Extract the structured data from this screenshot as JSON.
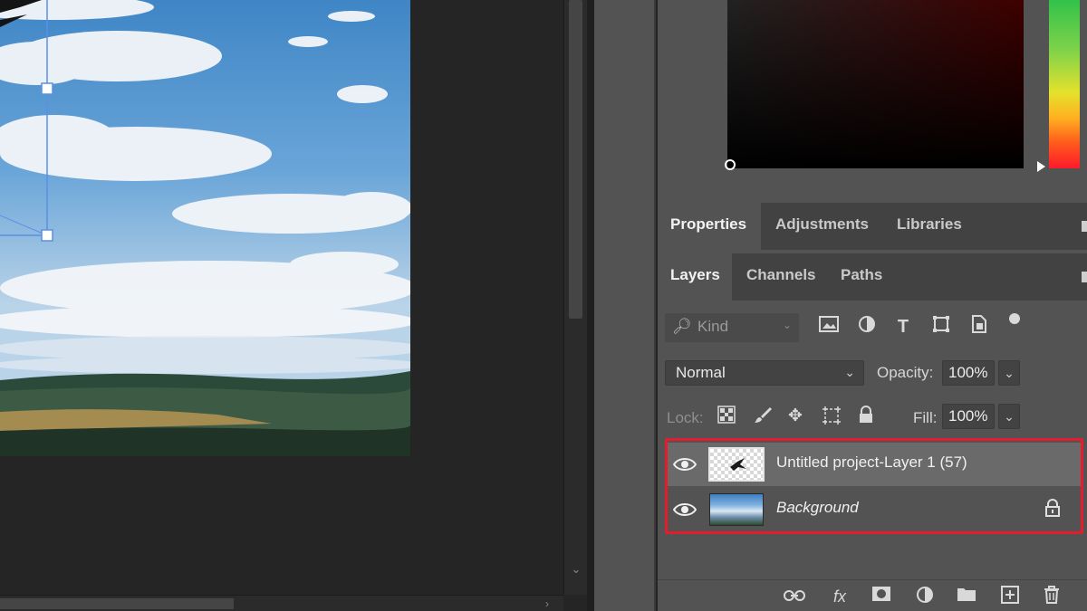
{
  "canvas": {
    "document": "landscape-sky-photo"
  },
  "panel_groups": {
    "top_tabs": [
      {
        "label": "Properties",
        "active": true
      },
      {
        "label": "Adjustments",
        "active": false
      },
      {
        "label": "Libraries",
        "active": false
      }
    ],
    "layer_tabs": [
      {
        "label": "Layers",
        "active": true
      },
      {
        "label": "Channels",
        "active": false
      },
      {
        "label": "Paths",
        "active": false
      }
    ]
  },
  "layers_panel": {
    "filter": {
      "icon": "search-icon",
      "placeholder": "Kind"
    },
    "blend_mode": "Normal",
    "opacity_label": "Opacity:",
    "opacity_value": "100%",
    "lock_label": "Lock:",
    "fill_label": "Fill:",
    "fill_value": "100%",
    "layers": [
      {
        "name": "Untitled project-Layer 1 (57)",
        "visible": true,
        "selected": true,
        "locked": false
      },
      {
        "name": "Background",
        "visible": true,
        "selected": false,
        "locked": true
      }
    ]
  },
  "colors": {
    "highlight": "#e11d2e",
    "panel_bg": "#535353",
    "tab_bar_bg": "#424242"
  }
}
